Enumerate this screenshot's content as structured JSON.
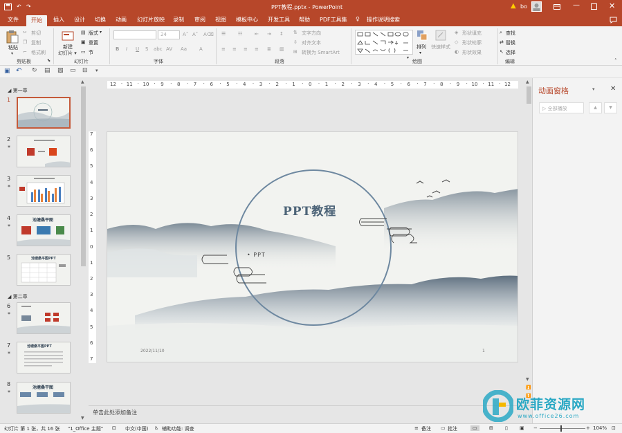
{
  "window": {
    "title": "PPT教程.pptx  -  PowerPoint",
    "user": "bo",
    "warning_icon": "warning-icon",
    "user_icon": "user-avatar-icon"
  },
  "tabs": [
    {
      "label": "文件"
    },
    {
      "label": "开始"
    },
    {
      "label": "插入"
    },
    {
      "label": "设计"
    },
    {
      "label": "切换"
    },
    {
      "label": "动画"
    },
    {
      "label": "幻灯片放映"
    },
    {
      "label": "录制"
    },
    {
      "label": "审阅"
    },
    {
      "label": "视图"
    },
    {
      "label": "模板中心"
    },
    {
      "label": "开发工具"
    },
    {
      "label": "帮助"
    },
    {
      "label": "PDF工具集"
    },
    {
      "label": "操作说明搜索"
    }
  ],
  "ribbon": {
    "clipboard": {
      "label": "剪贴板",
      "paste": "粘贴",
      "cut": "剪切",
      "copy": "复制",
      "format_painter": "格式刷"
    },
    "slides": {
      "label": "幻灯片",
      "new_slide": "新建\n幻灯片",
      "layout": "版式",
      "reset": "重置",
      "section": "节"
    },
    "font": {
      "label": "字体",
      "font_name": "",
      "font_size": "24"
    },
    "paragraph": {
      "label": "段落",
      "text_direction": "文字方向",
      "align_text": "对齐文本",
      "smartart": "转换为 SmartArt"
    },
    "drawing": {
      "label": "绘图",
      "arrange": "排列",
      "quick_styles": "快速样式",
      "fill": "形状填充",
      "outline": "形状轮廓",
      "effects": "形状效果"
    },
    "editing": {
      "label": "编辑",
      "find": "查找",
      "replace": "替换",
      "select": "选择"
    }
  },
  "thumbnails": {
    "section1": "第一章",
    "section2": "第二章",
    "slides": [
      {
        "num": "1",
        "star": ""
      },
      {
        "num": "2",
        "star": "*"
      },
      {
        "num": "3",
        "star": "*"
      },
      {
        "num": "4",
        "star": "*"
      },
      {
        "num": "5",
        "star": ""
      },
      {
        "num": "6",
        "star": "*"
      },
      {
        "num": "7",
        "star": "*"
      },
      {
        "num": "8",
        "star": "*"
      }
    ],
    "slide4_title": "池塘桑平图",
    "slide5_title": "池塘桑平图PPT",
    "slide7_title": "池塘桑平图PPT",
    "slide8_title": "池塘桑平图"
  },
  "ruler": {
    "h_ticks": [
      "12",
      "11",
      "10",
      "9",
      "8",
      "7",
      "6",
      "5",
      "4",
      "3",
      "2",
      "1",
      "0",
      "1",
      "2",
      "3",
      "4",
      "5",
      "6",
      "7",
      "8",
      "9",
      "10",
      "11",
      "12"
    ],
    "v_ticks": [
      "7",
      "6",
      "5",
      "4",
      "3",
      "2",
      "1",
      "0",
      "1",
      "2",
      "3",
      "4",
      "5",
      "6",
      "7"
    ]
  },
  "slide": {
    "title": "PPT教程",
    "subtitle": "• PPT",
    "date": "2022/11/10",
    "page_number": "1"
  },
  "notes": {
    "placeholder": "单击此处添加备注"
  },
  "animation_pane": {
    "title": "动画窗格",
    "play_all": "全部播放",
    "close_icon": "close-icon"
  },
  "statusbar": {
    "slide_info": "幻灯片 第 1 张，共 16 张",
    "theme": "\"1_Office 主题\"",
    "language": "中文(中国)",
    "accessibility": "辅助功能: 调查",
    "notes": "备注",
    "comments": "批注",
    "zoom": "104%"
  },
  "watermark": {
    "text": "欧菲资源网",
    "url": "www.office26.com"
  },
  "colors": {
    "accent": "#b7472a",
    "slide_bg": "#f2f3f0",
    "circle": "#6e88a0",
    "mountain": "#7b8a99"
  }
}
